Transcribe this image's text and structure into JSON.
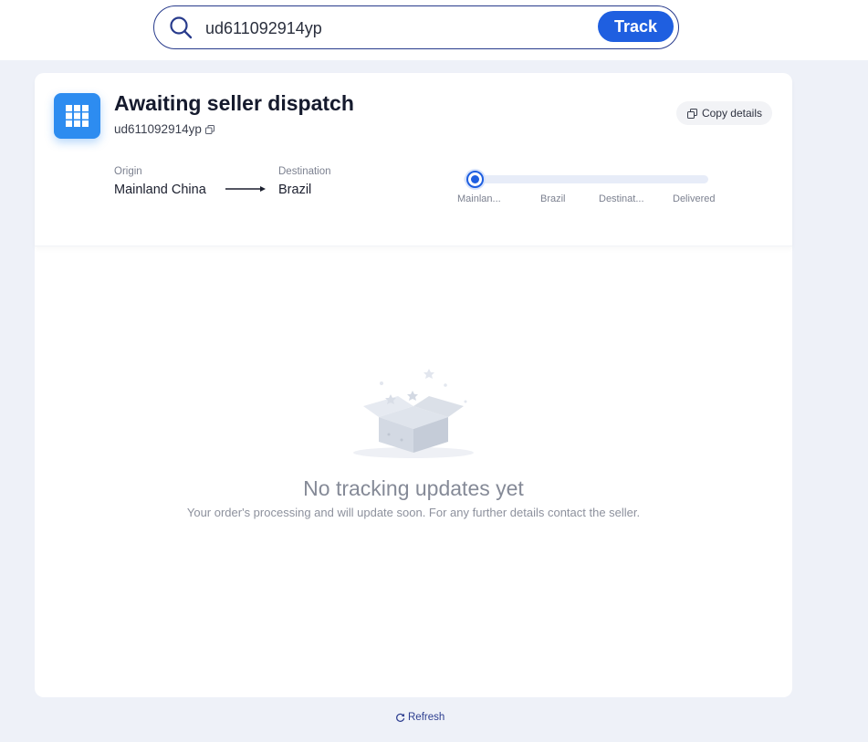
{
  "search": {
    "value": "ud611092914yp",
    "button_label": "Track"
  },
  "status": {
    "title": "Awaiting seller dispatch",
    "tracking_number": "ud611092914yp",
    "copy_details_label": "Copy details"
  },
  "route": {
    "origin_label": "Origin",
    "origin_value": "Mainland China",
    "destination_label": "Destination",
    "destination_value": "Brazil"
  },
  "progress": {
    "current_step": 1,
    "steps": [
      "Mainlan...",
      "Brazil",
      "Destinat...",
      "Delivered"
    ]
  },
  "empty_state": {
    "title": "No tracking updates yet",
    "description": "Your order's processing and will update soon. For any further details contact the seller."
  },
  "footer": {
    "refresh_label": "Refresh"
  },
  "colors": {
    "accent": "#1f5fe0",
    "status_tile": "#2d8cf0",
    "page_bg": "#eef1f8"
  },
  "icons": {
    "search": "search-icon",
    "status": "parcel-grid-icon",
    "copy": "copy-icon",
    "arrow": "arrow-right-icon",
    "refresh": "refresh-icon",
    "empty": "empty-box-icon"
  }
}
